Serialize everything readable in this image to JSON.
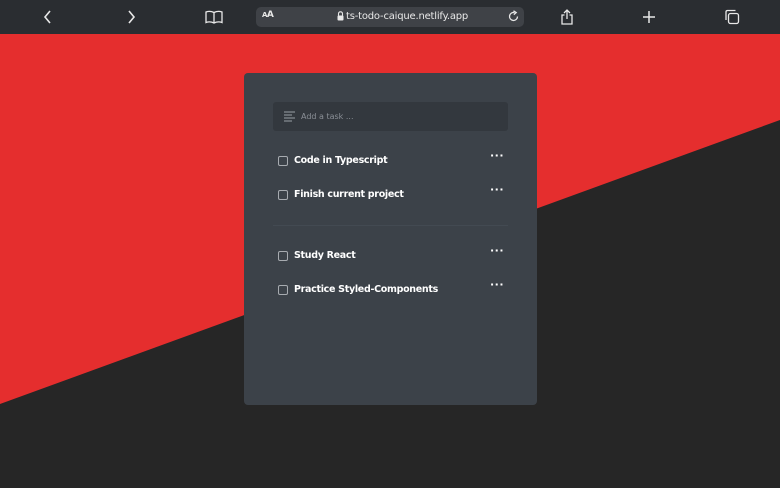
{
  "browser": {
    "address_prefix_small": "A",
    "address_prefix_large": "A",
    "url": "ts-todo-caique.netlify.app"
  },
  "colors": {
    "accent_red": "#e52e2e",
    "background_dark": "#262626",
    "card": "#3c4249"
  },
  "form": {
    "placeholder": "Add a task ..."
  },
  "tasks": {
    "pending": [
      {
        "label": "Code in Typescript"
      },
      {
        "label": "Finish current project"
      }
    ],
    "other": [
      {
        "label": "Study React"
      },
      {
        "label": "Practice Styled-Components"
      }
    ]
  },
  "more_glyph": "···"
}
